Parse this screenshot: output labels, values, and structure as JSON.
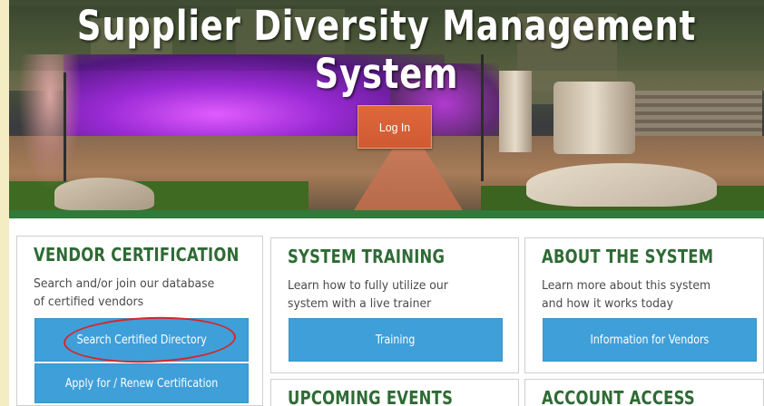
{
  "header": {
    "title": "Supplier Diversity Management System",
    "login_label": "Log In"
  },
  "cards": [
    {
      "title": "VENDOR CERTIFICATION",
      "description": "Search and/or join our database of certified vendors",
      "buttons": [
        "Search Certified Directory",
        "Apply for / Renew Certification"
      ]
    },
    {
      "title": "SYSTEM TRAINING",
      "description": "Learn how to fully utilize our system with a live trainer",
      "buttons": [
        "Training"
      ]
    },
    {
      "title": "ABOUT THE SYSTEM",
      "description": "Learn more about this system and how it works today",
      "buttons": [
        "Information for Vendors"
      ]
    },
    {
      "title": "UPCOMING EVENTS"
    },
    {
      "title": "ACCOUNT ACCESS"
    }
  ],
  "colors": {
    "heading_green": "#2e6b34",
    "button_blue": "#3f9fd9",
    "login_orange": "#d95f36",
    "annotation_red": "#d6262a",
    "outer_background": "#f4ecc3"
  }
}
